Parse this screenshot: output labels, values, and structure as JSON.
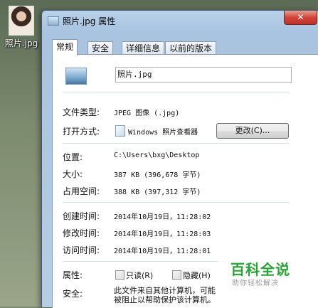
{
  "desktop": {
    "file_label": "照片.jpg"
  },
  "window": {
    "title": "照片.jpg 属性",
    "close_glyph": "✕"
  },
  "tabs": [
    "常规",
    "安全",
    "详细信息",
    "以前的版本"
  ],
  "general": {
    "file_name": "照片.jpg",
    "rows": {
      "type": {
        "label": "文件类型:",
        "value": "JPEG 图像 (.jpg)"
      },
      "opens_with": {
        "label": "打开方式:",
        "value": "Windows 照片查看器",
        "button": "更改(C)..."
      },
      "location": {
        "label": "位置:",
        "value": "C:\\Users\\bxg\\Desktop"
      },
      "size": {
        "label": "大小:",
        "value": "387 KB (396,678 字节)"
      },
      "size_on_disk": {
        "label": "占用空间:",
        "value": "388 KB (397,312 字节)"
      },
      "created": {
        "label": "创建时间:",
        "value": "2014年10月19日，11:28:02"
      },
      "modified": {
        "label": "修改时间:",
        "value": "2014年10月19日，11:28:03"
      },
      "accessed": {
        "label": "访问时间:",
        "value": "2014年10月19日，11:28:01"
      },
      "attributes": {
        "label": "属性:",
        "readonly": "只读(R)",
        "hidden": "隐藏(H)"
      },
      "security": {
        "label": "安全:",
        "text_line1": "此文件来自其他计算机，可能",
        "text_line2": "被阻止以帮助保护该计算机。"
      }
    }
  },
  "watermark": {
    "main": "百科全说",
    "sub": "助你轻松解决"
  }
}
